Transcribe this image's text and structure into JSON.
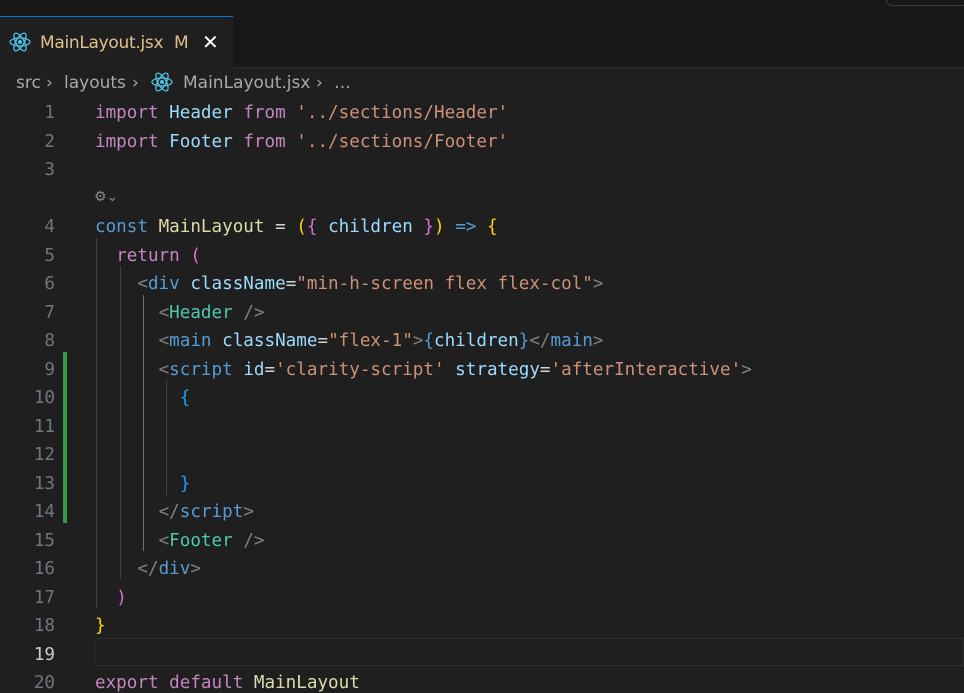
{
  "tab": {
    "title": "MainLayout.jsx",
    "modified": "M",
    "close": "✕"
  },
  "breadcrumb": [
    "src",
    "layouts",
    "MainLayout.jsx",
    "…"
  ],
  "lines": [
    {
      "n": "1",
      "y": 0
    },
    {
      "n": "2",
      "y": 1
    },
    {
      "n": "3",
      "y": 2
    },
    {
      "n": "4",
      "y": 4
    },
    {
      "n": "5",
      "y": 5
    },
    {
      "n": "6",
      "y": 6
    },
    {
      "n": "7",
      "y": 7
    },
    {
      "n": "8",
      "y": 8
    },
    {
      "n": "9",
      "y": 9
    },
    {
      "n": "10",
      "y": 10
    },
    {
      "n": "11",
      "y": 11
    },
    {
      "n": "12",
      "y": 12
    },
    {
      "n": "13",
      "y": 13
    },
    {
      "n": "14",
      "y": 14
    },
    {
      "n": "15",
      "y": 15
    },
    {
      "n": "16",
      "y": 16
    },
    {
      "n": "17",
      "y": 17
    },
    {
      "n": "18",
      "y": 18
    },
    {
      "n": "19",
      "y": 19,
      "active": true
    },
    {
      "n": "20",
      "y": 20
    }
  ],
  "code": [
    [
      [
        "import",
        "k-imp"
      ],
      [
        " ",
        "k-txt"
      ],
      [
        "Header",
        "k-var"
      ],
      [
        " ",
        "k-txt"
      ],
      [
        "from",
        "k-imp"
      ],
      [
        " ",
        "k-txt"
      ],
      [
        "'../sections/Header'",
        "k-str"
      ]
    ],
    [
      [
        "import",
        "k-imp"
      ],
      [
        " ",
        "k-txt"
      ],
      [
        "Footer",
        "k-var"
      ],
      [
        " ",
        "k-txt"
      ],
      [
        "from",
        "k-imp"
      ],
      [
        " ",
        "k-txt"
      ],
      [
        "'../sections/Footer'",
        "k-str"
      ]
    ],
    [],
    null,
    [
      [
        "const",
        "k-kw"
      ],
      [
        " ",
        "k-txt"
      ],
      [
        "MainLayout",
        "k-fn"
      ],
      [
        " = ",
        "k-txt"
      ],
      [
        "(",
        "b1"
      ],
      [
        "{",
        "b2"
      ],
      [
        " ",
        "k-txt"
      ],
      [
        "children",
        "k-var"
      ],
      [
        " ",
        "k-txt"
      ],
      [
        "}",
        "b2"
      ],
      [
        ")",
        "b1"
      ],
      [
        " ",
        "k-txt"
      ],
      [
        "=>",
        "k-kw"
      ],
      [
        " ",
        "k-txt"
      ],
      [
        "{",
        "b1"
      ]
    ],
    [
      [
        "  ",
        "k-txt"
      ],
      [
        "return",
        "k-imp"
      ],
      [
        " ",
        "k-txt"
      ],
      [
        "(",
        "b2"
      ]
    ],
    [
      [
        "    ",
        "k-txt"
      ],
      [
        "<",
        "k-ang"
      ],
      [
        "div",
        "k-tag"
      ],
      [
        " ",
        "k-txt"
      ],
      [
        "className",
        "k-var"
      ],
      [
        "=",
        "k-txt"
      ],
      [
        "\"min-h-screen flex flex-col\"",
        "k-str"
      ],
      [
        ">",
        "k-ang"
      ]
    ],
    [
      [
        "      ",
        "k-txt"
      ],
      [
        "<",
        "k-ang"
      ],
      [
        "Header",
        "k-cmp"
      ],
      [
        " ",
        "k-txt"
      ],
      [
        "/>",
        "k-ang"
      ]
    ],
    [
      [
        "      ",
        "k-txt"
      ],
      [
        "<",
        "k-ang"
      ],
      [
        "main",
        "k-tag"
      ],
      [
        " ",
        "k-txt"
      ],
      [
        "className",
        "k-var"
      ],
      [
        "=",
        "k-txt"
      ],
      [
        "\"flex-1\"",
        "k-str"
      ],
      [
        ">",
        "k-ang"
      ],
      [
        "{",
        "k-kw"
      ],
      [
        "children",
        "k-var"
      ],
      [
        "}",
        "k-kw"
      ],
      [
        "</",
        "k-ang"
      ],
      [
        "main",
        "k-tag"
      ],
      [
        ">",
        "k-ang"
      ]
    ],
    [
      [
        "      ",
        "k-txt"
      ],
      [
        "<",
        "k-ang"
      ],
      [
        "script",
        "k-tag"
      ],
      [
        " ",
        "k-txt"
      ],
      [
        "id",
        "k-var"
      ],
      [
        "=",
        "k-txt"
      ],
      [
        "'clarity-script'",
        "k-str"
      ],
      [
        " ",
        "k-txt"
      ],
      [
        "strategy",
        "k-var"
      ],
      [
        "=",
        "k-txt"
      ],
      [
        "'afterInteractive'",
        "k-str"
      ],
      [
        ">",
        "k-ang"
      ]
    ],
    [
      [
        "        ",
        "k-txt"
      ],
      [
        "{",
        "b3"
      ]
    ],
    [],
    [],
    [
      [
        "        ",
        "k-txt"
      ],
      [
        "}",
        "b3"
      ]
    ],
    [
      [
        "      ",
        "k-txt"
      ],
      [
        "</",
        "k-ang"
      ],
      [
        "script",
        "k-tag"
      ],
      [
        ">",
        "k-ang"
      ]
    ],
    [
      [
        "      ",
        "k-txt"
      ],
      [
        "<",
        "k-ang"
      ],
      [
        "Footer",
        "k-cmp"
      ],
      [
        " ",
        "k-txt"
      ],
      [
        "/>",
        "k-ang"
      ]
    ],
    [
      [
        "    ",
        "k-txt"
      ],
      [
        "</",
        "k-ang"
      ],
      [
        "div",
        "k-tag"
      ],
      [
        ">",
        "k-ang"
      ]
    ],
    [
      [
        "  ",
        "k-txt"
      ],
      [
        ")",
        "b2"
      ]
    ],
    [
      [
        "}",
        "b1"
      ]
    ],
    [],
    [
      [
        "export",
        "k-imp"
      ],
      [
        " ",
        "k-txt"
      ],
      [
        "default",
        "k-imp"
      ],
      [
        " ",
        "k-txt"
      ],
      [
        "MainLayout",
        "k-fn"
      ]
    ]
  ],
  "codelens_icon": "copilot-sparkle-icon"
}
